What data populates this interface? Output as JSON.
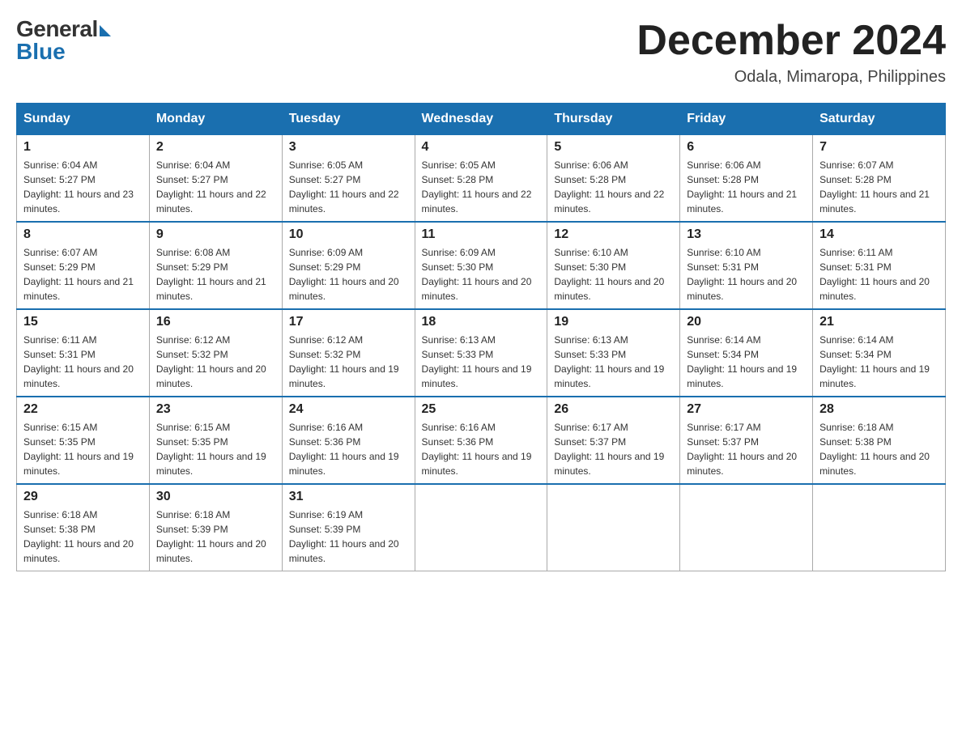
{
  "logo": {
    "general": "General",
    "blue": "Blue"
  },
  "header": {
    "month_year": "December 2024",
    "location": "Odala, Mimaropa, Philippines"
  },
  "days_of_week": [
    "Sunday",
    "Monday",
    "Tuesday",
    "Wednesday",
    "Thursday",
    "Friday",
    "Saturday"
  ],
  "weeks": [
    [
      {
        "day": "1",
        "sunrise": "Sunrise: 6:04 AM",
        "sunset": "Sunset: 5:27 PM",
        "daylight": "Daylight: 11 hours and 23 minutes."
      },
      {
        "day": "2",
        "sunrise": "Sunrise: 6:04 AM",
        "sunset": "Sunset: 5:27 PM",
        "daylight": "Daylight: 11 hours and 22 minutes."
      },
      {
        "day": "3",
        "sunrise": "Sunrise: 6:05 AM",
        "sunset": "Sunset: 5:27 PM",
        "daylight": "Daylight: 11 hours and 22 minutes."
      },
      {
        "day": "4",
        "sunrise": "Sunrise: 6:05 AM",
        "sunset": "Sunset: 5:28 PM",
        "daylight": "Daylight: 11 hours and 22 minutes."
      },
      {
        "day": "5",
        "sunrise": "Sunrise: 6:06 AM",
        "sunset": "Sunset: 5:28 PM",
        "daylight": "Daylight: 11 hours and 22 minutes."
      },
      {
        "day": "6",
        "sunrise": "Sunrise: 6:06 AM",
        "sunset": "Sunset: 5:28 PM",
        "daylight": "Daylight: 11 hours and 21 minutes."
      },
      {
        "day": "7",
        "sunrise": "Sunrise: 6:07 AM",
        "sunset": "Sunset: 5:28 PM",
        "daylight": "Daylight: 11 hours and 21 minutes."
      }
    ],
    [
      {
        "day": "8",
        "sunrise": "Sunrise: 6:07 AM",
        "sunset": "Sunset: 5:29 PM",
        "daylight": "Daylight: 11 hours and 21 minutes."
      },
      {
        "day": "9",
        "sunrise": "Sunrise: 6:08 AM",
        "sunset": "Sunset: 5:29 PM",
        "daylight": "Daylight: 11 hours and 21 minutes."
      },
      {
        "day": "10",
        "sunrise": "Sunrise: 6:09 AM",
        "sunset": "Sunset: 5:29 PM",
        "daylight": "Daylight: 11 hours and 20 minutes."
      },
      {
        "day": "11",
        "sunrise": "Sunrise: 6:09 AM",
        "sunset": "Sunset: 5:30 PM",
        "daylight": "Daylight: 11 hours and 20 minutes."
      },
      {
        "day": "12",
        "sunrise": "Sunrise: 6:10 AM",
        "sunset": "Sunset: 5:30 PM",
        "daylight": "Daylight: 11 hours and 20 minutes."
      },
      {
        "day": "13",
        "sunrise": "Sunrise: 6:10 AM",
        "sunset": "Sunset: 5:31 PM",
        "daylight": "Daylight: 11 hours and 20 minutes."
      },
      {
        "day": "14",
        "sunrise": "Sunrise: 6:11 AM",
        "sunset": "Sunset: 5:31 PM",
        "daylight": "Daylight: 11 hours and 20 minutes."
      }
    ],
    [
      {
        "day": "15",
        "sunrise": "Sunrise: 6:11 AM",
        "sunset": "Sunset: 5:31 PM",
        "daylight": "Daylight: 11 hours and 20 minutes."
      },
      {
        "day": "16",
        "sunrise": "Sunrise: 6:12 AM",
        "sunset": "Sunset: 5:32 PM",
        "daylight": "Daylight: 11 hours and 20 minutes."
      },
      {
        "day": "17",
        "sunrise": "Sunrise: 6:12 AM",
        "sunset": "Sunset: 5:32 PM",
        "daylight": "Daylight: 11 hours and 19 minutes."
      },
      {
        "day": "18",
        "sunrise": "Sunrise: 6:13 AM",
        "sunset": "Sunset: 5:33 PM",
        "daylight": "Daylight: 11 hours and 19 minutes."
      },
      {
        "day": "19",
        "sunrise": "Sunrise: 6:13 AM",
        "sunset": "Sunset: 5:33 PM",
        "daylight": "Daylight: 11 hours and 19 minutes."
      },
      {
        "day": "20",
        "sunrise": "Sunrise: 6:14 AM",
        "sunset": "Sunset: 5:34 PM",
        "daylight": "Daylight: 11 hours and 19 minutes."
      },
      {
        "day": "21",
        "sunrise": "Sunrise: 6:14 AM",
        "sunset": "Sunset: 5:34 PM",
        "daylight": "Daylight: 11 hours and 19 minutes."
      }
    ],
    [
      {
        "day": "22",
        "sunrise": "Sunrise: 6:15 AM",
        "sunset": "Sunset: 5:35 PM",
        "daylight": "Daylight: 11 hours and 19 minutes."
      },
      {
        "day": "23",
        "sunrise": "Sunrise: 6:15 AM",
        "sunset": "Sunset: 5:35 PM",
        "daylight": "Daylight: 11 hours and 19 minutes."
      },
      {
        "day": "24",
        "sunrise": "Sunrise: 6:16 AM",
        "sunset": "Sunset: 5:36 PM",
        "daylight": "Daylight: 11 hours and 19 minutes."
      },
      {
        "day": "25",
        "sunrise": "Sunrise: 6:16 AM",
        "sunset": "Sunset: 5:36 PM",
        "daylight": "Daylight: 11 hours and 19 minutes."
      },
      {
        "day": "26",
        "sunrise": "Sunrise: 6:17 AM",
        "sunset": "Sunset: 5:37 PM",
        "daylight": "Daylight: 11 hours and 19 minutes."
      },
      {
        "day": "27",
        "sunrise": "Sunrise: 6:17 AM",
        "sunset": "Sunset: 5:37 PM",
        "daylight": "Daylight: 11 hours and 20 minutes."
      },
      {
        "day": "28",
        "sunrise": "Sunrise: 6:18 AM",
        "sunset": "Sunset: 5:38 PM",
        "daylight": "Daylight: 11 hours and 20 minutes."
      }
    ],
    [
      {
        "day": "29",
        "sunrise": "Sunrise: 6:18 AM",
        "sunset": "Sunset: 5:38 PM",
        "daylight": "Daylight: 11 hours and 20 minutes."
      },
      {
        "day": "30",
        "sunrise": "Sunrise: 6:18 AM",
        "sunset": "Sunset: 5:39 PM",
        "daylight": "Daylight: 11 hours and 20 minutes."
      },
      {
        "day": "31",
        "sunrise": "Sunrise: 6:19 AM",
        "sunset": "Sunset: 5:39 PM",
        "daylight": "Daylight: 11 hours and 20 minutes."
      },
      null,
      null,
      null,
      null
    ]
  ]
}
